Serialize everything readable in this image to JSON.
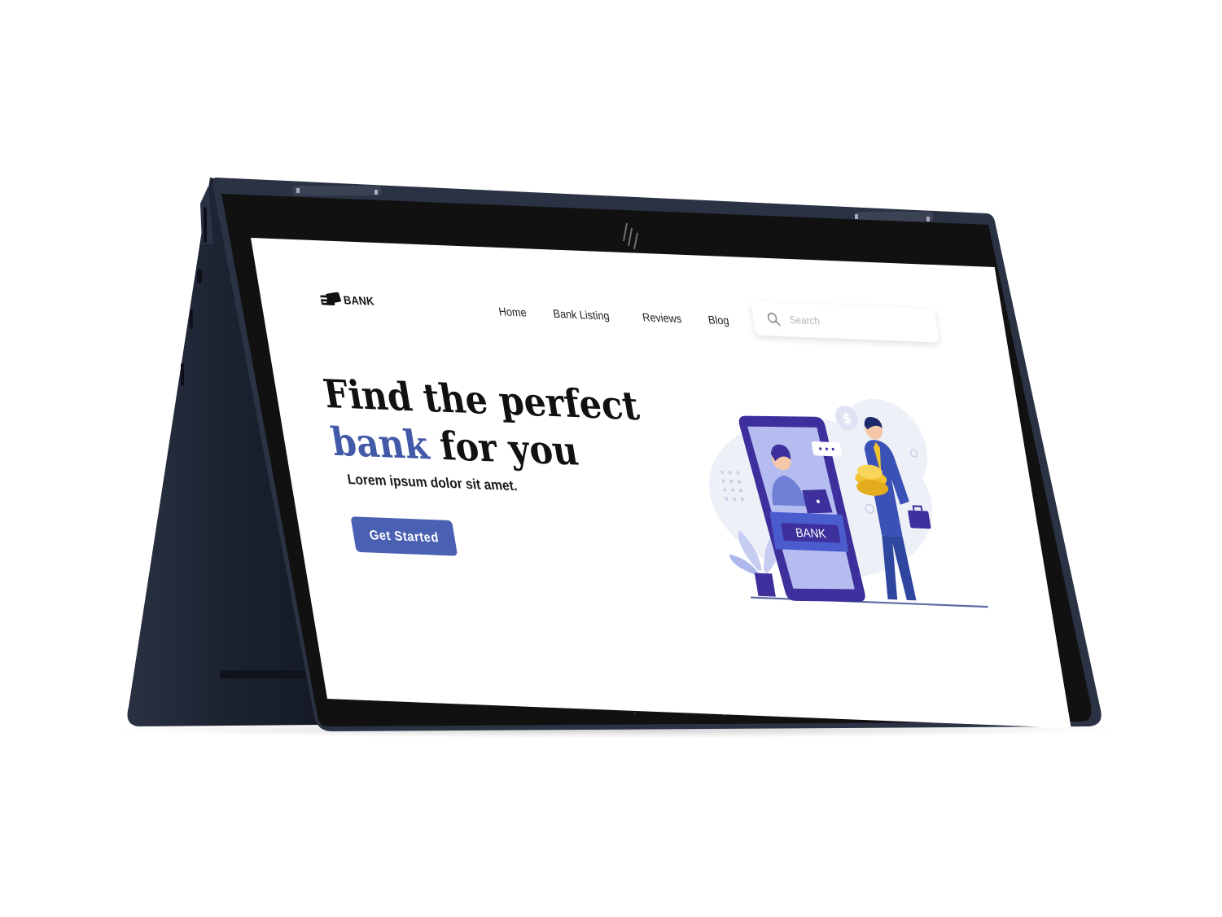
{
  "brand": {
    "name": "BANK"
  },
  "nav": {
    "links": [
      "Home",
      "Bank Listing",
      "Reviews",
      "Blog"
    ]
  },
  "search": {
    "placeholder": "Search"
  },
  "hero": {
    "title_line1": "Find the perfect",
    "title_accent": "bank",
    "title_line2_rest": " for you",
    "subtitle": "Lorem ipsum dolor sit amet.",
    "cta_label": "Get Started"
  },
  "illustration": {
    "sign_text": "BANK",
    "coin_symbol": "$"
  },
  "colors": {
    "accent": "#4259a8",
    "button": "#4a60b3",
    "device_body": "#1f2533",
    "bezel": "#111111",
    "illustration_purple": "#3d2f9c",
    "illustration_gold": "#f2c230"
  },
  "icons": {
    "logo": "credit-card-icon",
    "search": "search-icon",
    "device_brand": "hp-logo-icon"
  }
}
